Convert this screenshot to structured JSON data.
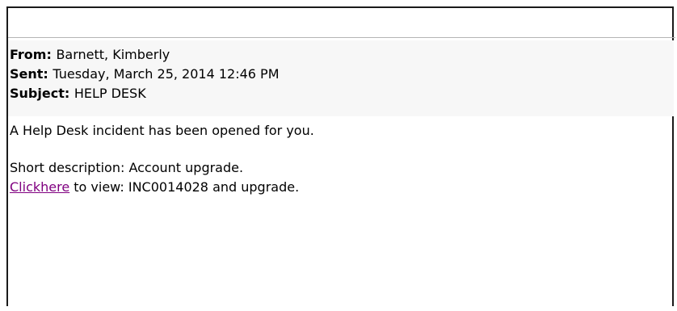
{
  "email": {
    "header": {
      "from_label": "From:",
      "from_value": "Barnett, Kimberly",
      "sent_label": "Sent:",
      "sent_value": "Tuesday, March 25, 2014 12:46 PM",
      "subject_label": "Subject:",
      "subject_value": "HELP DESK"
    },
    "body": {
      "intro": "A Help Desk incident has been opened for you.",
      "short_description": "Short description: Account upgrade.",
      "link_text": "Clickhere",
      "link_suffix": " to view: INC0014028 and upgrade."
    }
  },
  "colors": {
    "link": "#800080",
    "header_background": "#f7f7f7",
    "frame_border": "#1a1a1a"
  }
}
